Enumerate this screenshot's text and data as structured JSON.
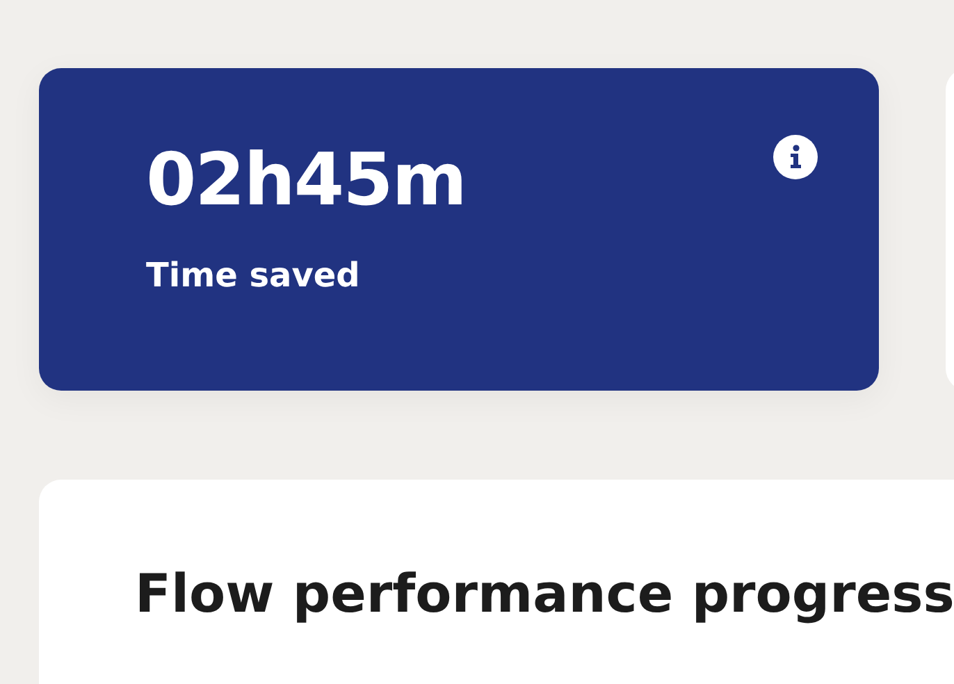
{
  "stat_card": {
    "value": "02h45m",
    "label": "Time saved"
  },
  "performance_card": {
    "title": "Flow performance progress"
  }
}
